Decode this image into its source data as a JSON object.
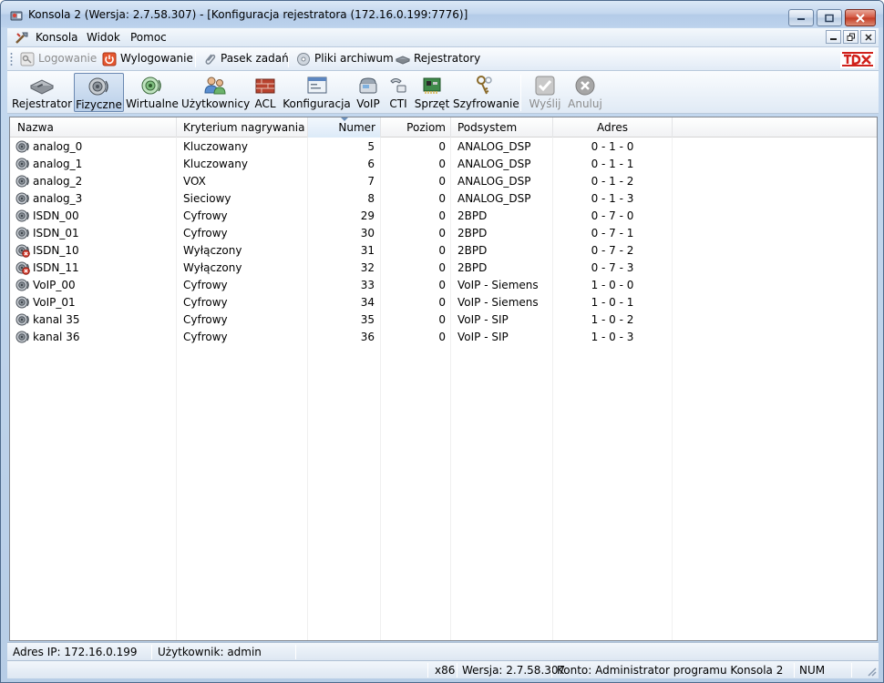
{
  "window": {
    "title": "Konsola 2 (Wersja:  2.7.58.307) - [Konfiguracja rejestratora (172.16.0.199:7776)]"
  },
  "menu": {
    "items": [
      {
        "label": "Konsola"
      },
      {
        "label": "Widok"
      },
      {
        "label": "Pomoc"
      }
    ]
  },
  "toolbar_top": {
    "items": [
      {
        "label": "Logowanie",
        "icon": "key-icon",
        "enabled": false
      },
      {
        "label": "Wylogowanie",
        "icon": "power-icon",
        "enabled": true
      },
      {
        "label": "Pasek zadań",
        "icon": "paperclip-icon",
        "enabled": true
      },
      {
        "label": "Pliki archiwum",
        "icon": "disc-icon",
        "enabled": true
      },
      {
        "label": "Rejestratory",
        "icon": "recorder-icon",
        "enabled": true
      }
    ]
  },
  "toolbar_main": {
    "items": [
      {
        "label": "Rejestrator",
        "icon": "recorder-device-icon"
      },
      {
        "label": "Fizyczne",
        "icon": "speaker-icon",
        "active": true
      },
      {
        "label": "Wirtualne",
        "icon": "virtual-speaker-icon"
      },
      {
        "label": "Użytkownicy",
        "icon": "users-icon"
      },
      {
        "label": "ACL",
        "icon": "firewall-icon"
      },
      {
        "label": "Konfiguracja",
        "icon": "config-window-icon"
      },
      {
        "label": "VoIP",
        "icon": "voip-phone-icon"
      },
      {
        "label": "CTI",
        "icon": "cti-phone-icon"
      },
      {
        "label": "Sprzęt",
        "icon": "hardware-card-icon"
      },
      {
        "label": "Szyfrowanie",
        "icon": "encryption-keys-icon"
      },
      {
        "label": "Wyślij",
        "icon": "check-icon",
        "enabled": false
      },
      {
        "label": "Anuluj",
        "icon": "cancel-icon",
        "enabled": false
      }
    ]
  },
  "table": {
    "sorted_column": "Numer",
    "columns": [
      "Nazwa",
      "Kryterium nagrywania",
      "Numer",
      "Poziom",
      "Podsystem",
      "Adres"
    ],
    "rows": [
      {
        "name": "analog_0",
        "criterion": "Kluczowany",
        "number": "5",
        "level": "0",
        "subsystem": "ANALOG_DSP",
        "address": "0 - 1 - 0",
        "disabled": false
      },
      {
        "name": "analog_1",
        "criterion": "Kluczowany",
        "number": "6",
        "level": "0",
        "subsystem": "ANALOG_DSP",
        "address": "0 - 1 - 1",
        "disabled": false
      },
      {
        "name": "analog_2",
        "criterion": "VOX",
        "number": "7",
        "level": "0",
        "subsystem": "ANALOG_DSP",
        "address": "0 - 1 - 2",
        "disabled": false
      },
      {
        "name": "analog_3",
        "criterion": "Sieciowy",
        "number": "8",
        "level": "0",
        "subsystem": "ANALOG_DSP",
        "address": "0 - 1 - 3",
        "disabled": false
      },
      {
        "name": "ISDN_00",
        "criterion": "Cyfrowy",
        "number": "29",
        "level": "0",
        "subsystem": "2BPD",
        "address": "0 - 7 - 0",
        "disabled": false
      },
      {
        "name": "ISDN_01",
        "criterion": "Cyfrowy",
        "number": "30",
        "level": "0",
        "subsystem": "2BPD",
        "address": "0 - 7 - 1",
        "disabled": false
      },
      {
        "name": "ISDN_10",
        "criterion": "Wyłączony",
        "number": "31",
        "level": "0",
        "subsystem": "2BPD",
        "address": "0 - 7 - 2",
        "disabled": true
      },
      {
        "name": "ISDN_11",
        "criterion": "Wyłączony",
        "number": "32",
        "level": "0",
        "subsystem": "2BPD",
        "address": "0 - 7 - 3",
        "disabled": true
      },
      {
        "name": "VoIP_00",
        "criterion": "Cyfrowy",
        "number": "33",
        "level": "0",
        "subsystem": "VoIP - Siemens",
        "address": "1 - 0 - 0",
        "disabled": false
      },
      {
        "name": "VoIP_01",
        "criterion": "Cyfrowy",
        "number": "34",
        "level": "0",
        "subsystem": "VoIP - Siemens",
        "address": "1 - 0 - 1",
        "disabled": false
      },
      {
        "name": "kanal 35",
        "criterion": "Cyfrowy",
        "number": "35",
        "level": "0",
        "subsystem": "VoIP - SIP",
        "address": "1 - 0 - 2",
        "disabled": false
      },
      {
        "name": "kanal 36",
        "criterion": "Cyfrowy",
        "number": "36",
        "level": "0",
        "subsystem": "VoIP - SIP",
        "address": "1 - 0 - 3",
        "disabled": false
      }
    ]
  },
  "status": {
    "ip": "Adres IP: 172.16.0.199",
    "user": "Użytkownik: admin",
    "arch": "x86",
    "version": "Wersja: 2.7.58.307",
    "account": "Konto: Administrator programu Konsola 2",
    "num": "NUM"
  },
  "colors": {
    "titlebar": "#c2d6ee",
    "selection_header": "#dceaf8",
    "disabled_text": "#8c8c8c",
    "close_button": "#c33b24"
  }
}
